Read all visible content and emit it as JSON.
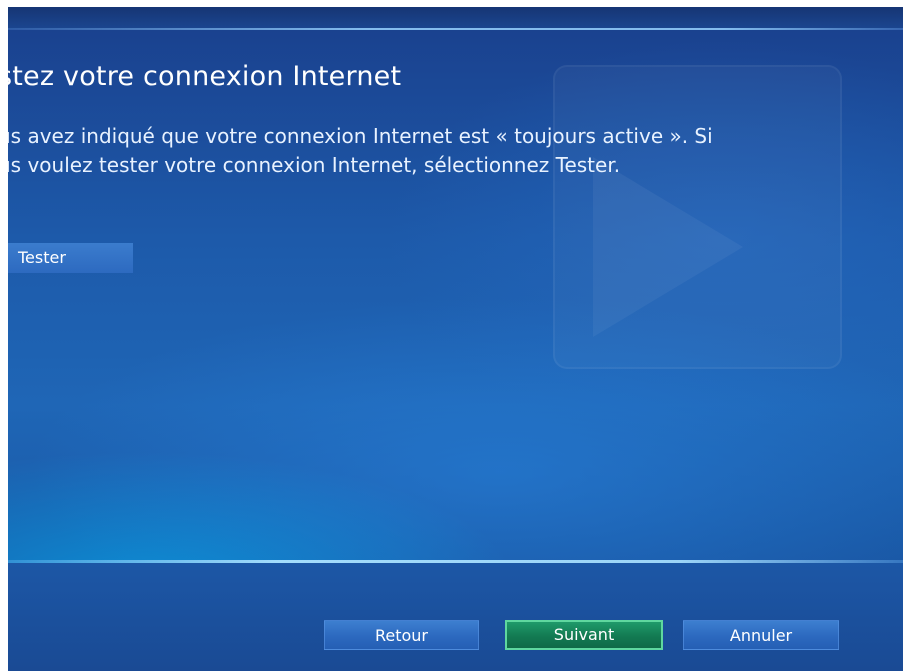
{
  "page": {
    "title": "stez votre connexion Internet",
    "description_lines": [
      "us avez indiqué que votre connexion Internet est « toujours active ». Si",
      "us voulez tester votre connexion Internet, sélectionnez Tester."
    ]
  },
  "actions": {
    "test_label": "Tester"
  },
  "footer": {
    "back_label": "Retour",
    "next_label": "Suivant",
    "cancel_label": "Annuler"
  },
  "colors": {
    "background": "#1d5aaa",
    "focused_button": "#137a52",
    "focused_border": "#5fd79f",
    "button": "#2c69bf"
  },
  "icons": {
    "watermark": "forward-arrow-icon"
  }
}
